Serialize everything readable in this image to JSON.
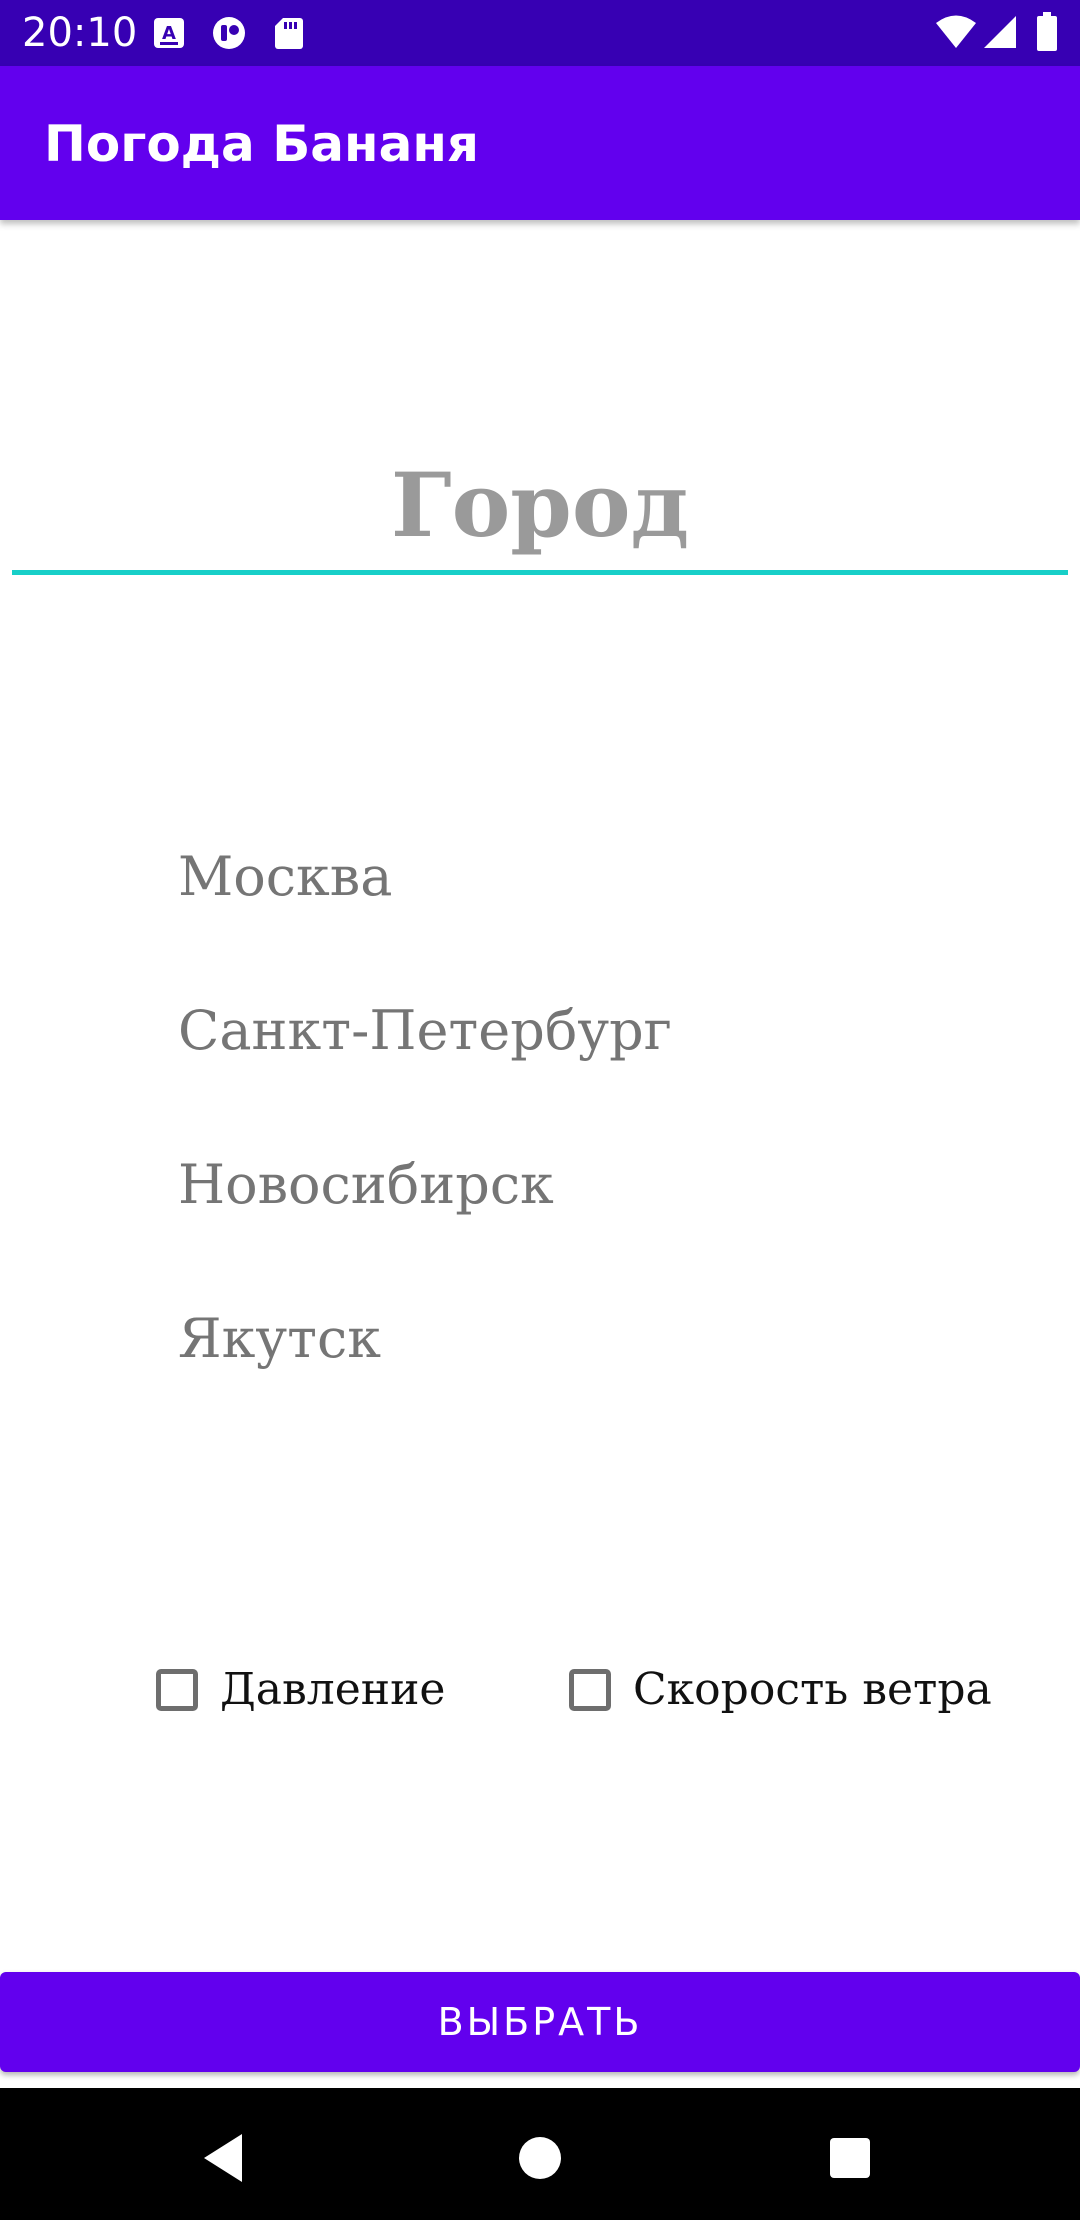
{
  "status_bar": {
    "time": "20:10",
    "icons": [
      "translate-icon",
      "app-notification-icon",
      "sd-card-icon",
      "wifi-icon",
      "signal-icon",
      "battery-icon"
    ],
    "color": "#3700b3"
  },
  "app_bar": {
    "title": "Погода Бананя",
    "color": "#6200ee"
  },
  "city_input": {
    "placeholder": "Город",
    "value": "",
    "underline_color": "#18cfc8"
  },
  "cities": [
    {
      "label": "Москва"
    },
    {
      "label": "Санкт-Петербург"
    },
    {
      "label": "Новосибирск"
    },
    {
      "label": "Якутск"
    }
  ],
  "options": [
    {
      "label": "Давление",
      "checked": false
    },
    {
      "label": "Скорость ветра",
      "checked": false
    }
  ],
  "select_button": {
    "label": "ВЫБРАТЬ"
  },
  "nav_bar": {
    "buttons": [
      "back-icon",
      "home-icon",
      "recents-icon"
    ]
  }
}
